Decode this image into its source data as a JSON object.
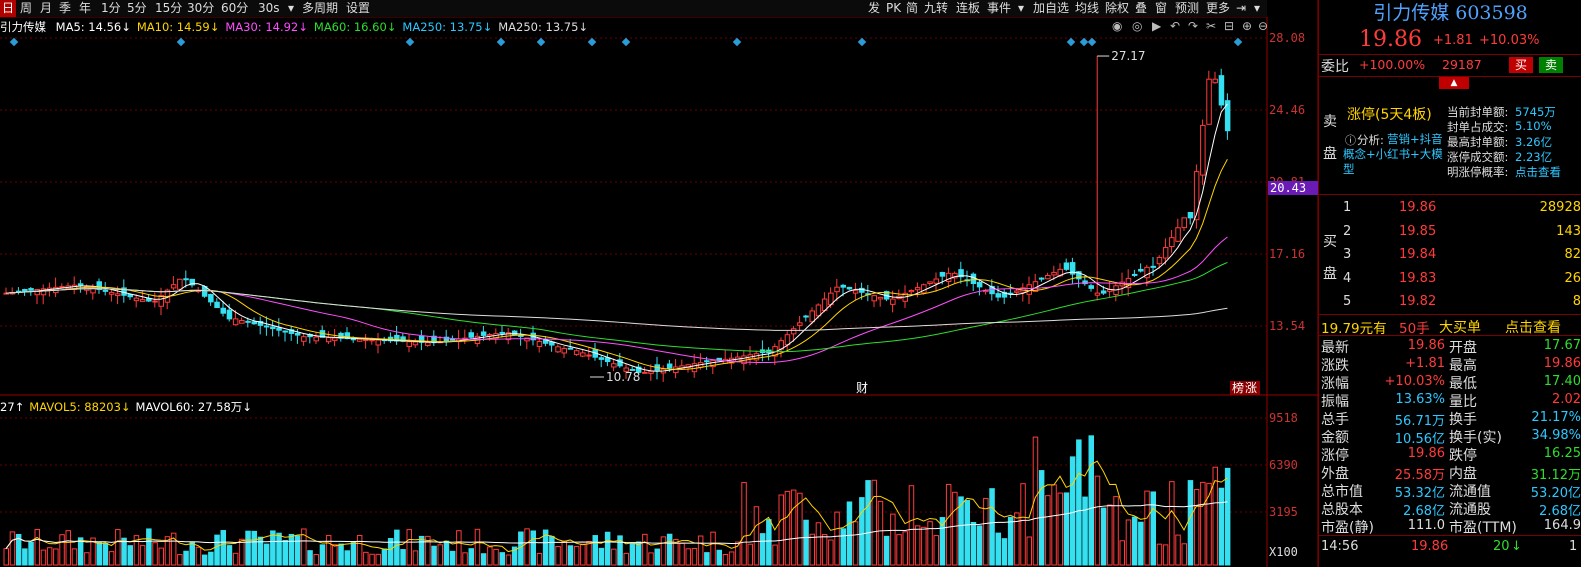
{
  "toolbar": {
    "left": [
      "日",
      "周",
      "月",
      "季",
      "年",
      "1分",
      "5分",
      "15分",
      "30分",
      "60分",
      "30s",
      "▾",
      "多周期",
      "设置"
    ],
    "right": [
      "发",
      "PK",
      "简",
      "九转",
      "连板",
      "事件",
      "▾",
      "加自选",
      "均线",
      "除权",
      "叠",
      "窗",
      "预测",
      "更多"
    ],
    "icons": [
      "exit-icon",
      "menu-down-icon"
    ]
  },
  "legend": {
    "name": "引力传媒",
    "ma": [
      {
        "label": "MA5: 14.56↓",
        "color": "#ffffff"
      },
      {
        "label": "MA10: 14.59↓",
        "color": "#ffd400"
      },
      {
        "label": "MA30: 14.92↓",
        "color": "#ff4fff"
      },
      {
        "label": "MA60: 16.60↓",
        "color": "#2ede2e"
      },
      {
        "label": "MA250: 13.75↓",
        "color": "#2ec8ff"
      },
      {
        "label": "MA250: 13.75↓",
        "color": "#dddddd"
      }
    ]
  },
  "vol_legend": {
    "items": [
      {
        "label": "27↑",
        "color": "#ffffff"
      },
      {
        "label": "MAVOL5: 88203↓",
        "color": "#ffd400"
      },
      {
        "label": "MAVOL60: 27.58万↓",
        "color": "#ffffff"
      }
    ]
  },
  "price_axis": [
    "28.08",
    "24.46",
    "20.81",
    "17.16",
    "13.54"
  ],
  "current_price_tag": "20.43",
  "vol_axis": [
    "9518",
    "6390",
    "3195",
    "X100"
  ],
  "annotations": {
    "high": "27.17",
    "low": "10.78",
    "cai": "财",
    "bang": "榜",
    "zhang": "涨"
  },
  "right_panel": {
    "title": "引力传媒 603598",
    "price": "19.86",
    "change": "+1.81",
    "pct": "+10.03%",
    "weibi_label": "委比",
    "weibi": "+100.00%",
    "weicha": "29187",
    "buy_btn": "买",
    "sell_btn": "卖",
    "sell_side": "卖盘",
    "buy_side": "买盘",
    "limit_title": "涨停(5天4板)",
    "analysis_prefix": "分析:",
    "analysis_text": "营销+抖音概念+小红书+大模型",
    "limit_info": [
      {
        "k": "当前封单额:",
        "v": "5745万"
      },
      {
        "k": "封单占成交:",
        "v": "5.10%"
      },
      {
        "k": "最高封单额:",
        "v": "3.26亿"
      },
      {
        "k": "涨停成交额:",
        "v": "2.23亿"
      },
      {
        "k": "明涨停概率:",
        "v": "点击查看"
      }
    ],
    "bids": [
      {
        "lvl": "1",
        "price": "19.86",
        "vol": "28928"
      },
      {
        "lvl": "2",
        "price": "19.85",
        "vol": "143"
      },
      {
        "lvl": "3",
        "price": "19.84",
        "vol": "82"
      },
      {
        "lvl": "4",
        "price": "19.83",
        "vol": "26"
      },
      {
        "lvl": "5",
        "price": "19.82",
        "vol": "8"
      }
    ],
    "big_order": {
      "amt": "19.79元有",
      "qty": "50手",
      "label": "大买单",
      "link": "点击查看"
    },
    "stats": [
      {
        "k1": "最新",
        "v1": "19.86",
        "c1": "red",
        "k2": "开盘",
        "v2": "17.67",
        "c2": "green"
      },
      {
        "k1": "涨跌",
        "v1": "+1.81",
        "c1": "red",
        "k2": "最高",
        "v2": "19.86",
        "c2": "red"
      },
      {
        "k1": "涨幅",
        "v1": "+10.03%",
        "c1": "red",
        "k2": "最低",
        "v2": "17.40",
        "c2": "green"
      },
      {
        "k1": "振幅",
        "v1": "13.63%",
        "c1": "cyan",
        "k2": "量比",
        "v2": "2.02",
        "c2": "red"
      },
      {
        "k1": "总手",
        "v1": "56.71万",
        "c1": "cyan",
        "k2": "换手",
        "v2": "21.17%",
        "c2": "cyan"
      },
      {
        "k1": "金额",
        "v1": "10.56亿",
        "c1": "cyan",
        "k2": "换手(实)",
        "v2": "34.98%",
        "c2": "cyan"
      },
      {
        "k1": "涨停",
        "v1": "19.86",
        "c1": "red",
        "k2": "跌停",
        "v2": "16.25",
        "c2": "green"
      },
      {
        "k1": "外盘",
        "v1": "25.58万",
        "c1": "red",
        "k2": "内盘",
        "v2": "31.12万",
        "c2": "green"
      },
      {
        "k1": "总市值",
        "v1": "53.32亿",
        "c1": "cyan",
        "k2": "流通值",
        "v2": "53.20亿",
        "c2": "cyan"
      },
      {
        "k1": "总股本",
        "v1": "2.68亿",
        "c1": "cyan",
        "k2": "流通股",
        "v2": "2.68亿",
        "c2": "cyan"
      },
      {
        "k1": "市盈(静)",
        "v1": "111.0",
        "c1": "white",
        "k2": "市盈(TTM)",
        "v2": "164.9",
        "c2": "white"
      }
    ],
    "tick": {
      "time": "14:56",
      "price": "19.86",
      "vol": "20",
      "dir": "↓",
      "last": "1"
    }
  },
  "colors": {
    "up": "#ff3b3b",
    "down": "#35e0f0",
    "bg": "#000000",
    "grid": "#6a0000"
  }
}
